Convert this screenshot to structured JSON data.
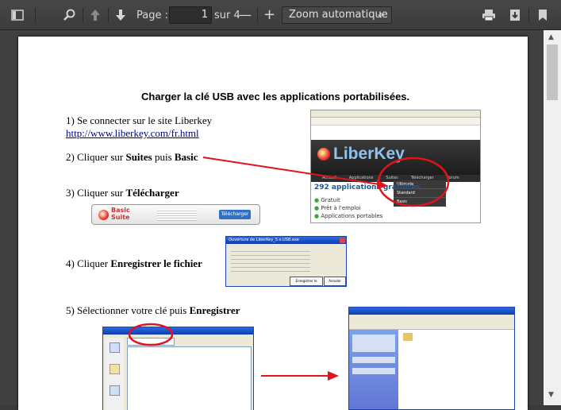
{
  "toolbar": {
    "page_label": "Page :",
    "page_value": "1",
    "page_total": "sur 4",
    "zoom_value": "Zoom automatique",
    "zoom_minus": "—",
    "zoom_plus": "+",
    "zoom_arrow": "÷"
  },
  "document": {
    "title": "Charger la clé USB avec les applications portabilisées.",
    "step1_text": "1) Se connecter sur le site Liberkey",
    "step1_link": "http://www.liberkey.com/fr.html",
    "step2_prefix": "2) Cliquer sur ",
    "step2_suites": "Suites",
    "step2_mid": " puis ",
    "step2_basic": "Basic",
    "step3_prefix": "3) Cliquer sur ",
    "step3_bold": "Télécharger",
    "step4_prefix": "4) Cliquer ",
    "step4_bold": "Enregistrer le fichier",
    "step5_prefix": "5) Sélectionner votre clé puis ",
    "step5_bold": "Enregistrer"
  },
  "liberkey_shot": {
    "logo": "LiberKey",
    "menu_items": [
      "Accueil",
      "Applications",
      "Suites",
      "Télécharger",
      "Forum"
    ],
    "dropdown": [
      "Ultimate",
      "Standard",
      "Basic"
    ],
    "headline": "292 applications gratuites",
    "features": [
      "Gratuit",
      "Prêt à l'emploi",
      "Applications portables"
    ]
  },
  "basic_suite_shot": {
    "name_top": "Basic",
    "name_bottom": "Suite",
    "download": "Télécharger"
  },
  "dialog_shot": {
    "title": "Ouverture de LiberKey_5.x.USB.exe",
    "save_btn": "Enregistrer le fichier",
    "cancel_btn": "Annuler"
  },
  "colors": {
    "toolbar_bg": "#434343",
    "annotation_red": "#e0141a",
    "xp_blue": "#245edc"
  }
}
